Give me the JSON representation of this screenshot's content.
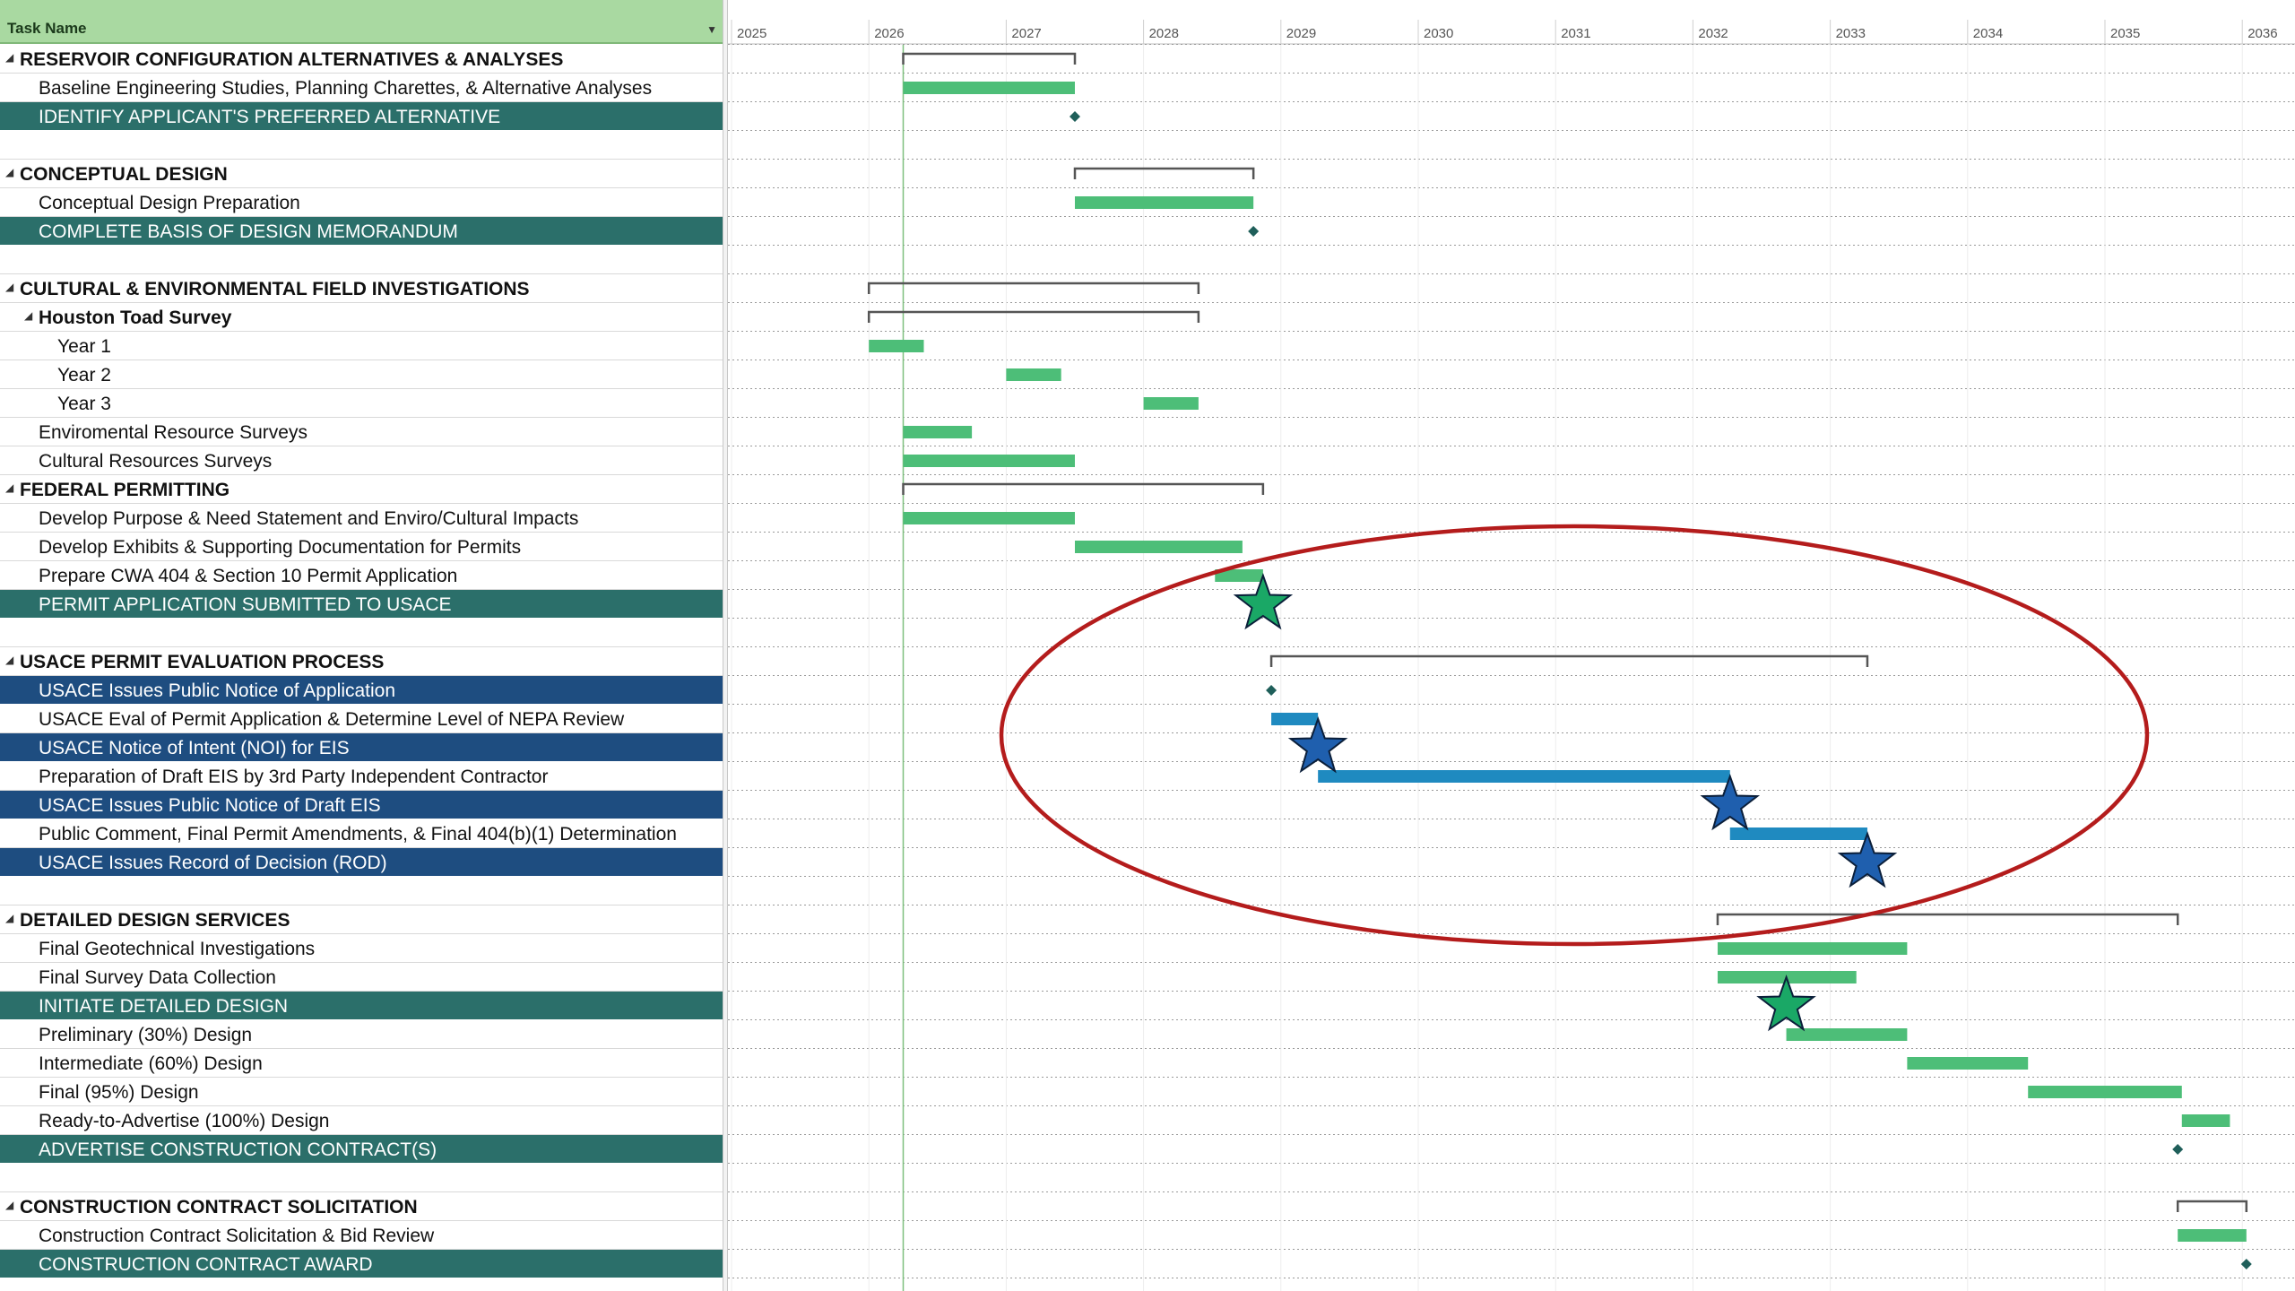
{
  "header": {
    "task_name_label": "Task Name"
  },
  "timescale": {
    "years": [
      "2025",
      "2026",
      "2027",
      "2028",
      "2029",
      "2030",
      "2031",
      "2032",
      "2033",
      "2034",
      "2035",
      "2036"
    ]
  },
  "tasks": [
    {
      "name": "RESERVOIR CONFIGURATION ALTERNATIVES & ANALYSES",
      "kind": "summary",
      "level": 0,
      "start": 2026.25,
      "end": 2027.5
    },
    {
      "name": "Baseline Engineering Studies, Planning Charettes, & Alternative Analyses",
      "kind": "task",
      "level": 1,
      "start": 2026.25,
      "end": 2027.5,
      "color": "green"
    },
    {
      "name": "IDENTIFY APPLICANT'S PREFERRED ALTERNATIVE",
      "kind": "milestone",
      "level": 1,
      "style": "teal",
      "at": 2027.5
    },
    {
      "kind": "blank"
    },
    {
      "name": "CONCEPTUAL DESIGN",
      "kind": "summary",
      "level": 0,
      "start": 2027.5,
      "end": 2028.8
    },
    {
      "name": "Conceptual Design Preparation",
      "kind": "task",
      "level": 1,
      "start": 2027.5,
      "end": 2028.8,
      "color": "green"
    },
    {
      "name": "COMPLETE BASIS OF DESIGN MEMORANDUM",
      "kind": "milestone",
      "level": 1,
      "style": "teal",
      "at": 2028.8
    },
    {
      "kind": "blank"
    },
    {
      "name": "CULTURAL & ENVIRONMENTAL FIELD INVESTIGATIONS",
      "kind": "summary",
      "level": 0,
      "start": 2026.0,
      "end": 2028.4
    },
    {
      "name": "Houston Toad Survey",
      "kind": "summary",
      "level": 1,
      "start": 2026.0,
      "end": 2028.4
    },
    {
      "name": "Year 1",
      "kind": "task",
      "level": 2,
      "start": 2026.0,
      "end": 2026.4,
      "color": "green"
    },
    {
      "name": "Year 2",
      "kind": "task",
      "level": 2,
      "start": 2027.0,
      "end": 2027.4,
      "color": "green"
    },
    {
      "name": "Year 3",
      "kind": "task",
      "level": 2,
      "start": 2028.0,
      "end": 2028.4,
      "color": "green"
    },
    {
      "name": "Enviromental Resource Surveys",
      "kind": "task",
      "level": 1,
      "start": 2026.25,
      "end": 2026.75,
      "color": "green"
    },
    {
      "name": "Cultural Resources Surveys",
      "kind": "task",
      "level": 1,
      "start": 2026.25,
      "end": 2027.5,
      "color": "green"
    },
    {
      "name": "FEDERAL PERMITTING",
      "kind": "summary",
      "level": 0,
      "start": 2026.25,
      "end": 2028.87
    },
    {
      "name": "Develop Purpose & Need Statement and Enviro/Cultural Impacts",
      "kind": "task",
      "level": 1,
      "start": 2026.25,
      "end": 2027.5,
      "color": "green"
    },
    {
      "name": "Develop Exhibits & Supporting Documentation for Permits",
      "kind": "task",
      "level": 1,
      "start": 2027.5,
      "end": 2028.72,
      "color": "green"
    },
    {
      "name": "Prepare CWA 404 & Section 10  Permit Application",
      "kind": "task",
      "level": 1,
      "start": 2028.52,
      "end": 2028.87,
      "color": "green"
    },
    {
      "name": "PERMIT APPLICATION SUBMITTED TO USACE",
      "kind": "milestone",
      "level": 1,
      "style": "teal",
      "at": 2028.87
    },
    {
      "kind": "blank"
    },
    {
      "name": "USACE PERMIT EVALUATION PROCESS",
      "kind": "summary",
      "level": 0,
      "start": 2028.93,
      "end": 2033.27
    },
    {
      "name": "USACE Issues Public Notice of Application",
      "kind": "milestone",
      "level": 1,
      "style": "blue",
      "at": 2028.93
    },
    {
      "name": "USACE Eval of Permit Application & Determine Level of NEPA Review",
      "kind": "task",
      "level": 1,
      "start": 2028.93,
      "end": 2029.27,
      "color": "blue"
    },
    {
      "name": "USACE Notice of Intent (NOI) for EIS",
      "kind": "milestone",
      "level": 1,
      "style": "blue",
      "at": 2029.27
    },
    {
      "name": "Preparation of Draft EIS by 3rd Party Independent Contractor",
      "kind": "task",
      "level": 1,
      "start": 2029.27,
      "end": 2032.27,
      "color": "blue"
    },
    {
      "name": "USACE Issues Public Notice of Draft EIS",
      "kind": "milestone",
      "level": 1,
      "style": "blue",
      "at": 2032.27
    },
    {
      "name": "Public Comment, Final Permit Amendments, & Final 404(b)(1) Determination",
      "kind": "task",
      "level": 1,
      "start": 2032.27,
      "end": 2033.27,
      "color": "blue"
    },
    {
      "name": "USACE Issues Record of Decision (ROD)",
      "kind": "milestone",
      "level": 1,
      "style": "blue",
      "at": 2033.27
    },
    {
      "kind": "blank"
    },
    {
      "name": "DETAILED DESIGN SERVICES",
      "kind": "summary",
      "level": 0,
      "start": 2032.18,
      "end": 2035.53
    },
    {
      "name": "Final Geotechnical Investigations",
      "kind": "task",
      "level": 1,
      "start": 2032.18,
      "end": 2033.56,
      "color": "green"
    },
    {
      "name": "Final Survey Data Collection",
      "kind": "task",
      "level": 1,
      "start": 2032.18,
      "end": 2033.19,
      "color": "green"
    },
    {
      "name": "INITIATE DETAILED DESIGN",
      "kind": "milestone",
      "level": 1,
      "style": "teal",
      "at": 2032.68
    },
    {
      "name": "Preliminary (30%) Design",
      "kind": "task",
      "level": 1,
      "start": 2032.68,
      "end": 2033.56,
      "color": "green"
    },
    {
      "name": "Intermediate (60%) Design",
      "kind": "task",
      "level": 1,
      "start": 2033.56,
      "end": 2034.44,
      "color": "green"
    },
    {
      "name": "Final (95%) Design",
      "kind": "task",
      "level": 1,
      "start": 2034.44,
      "end": 2035.56,
      "color": "green"
    },
    {
      "name": "Ready-to-Advertise (100%) Design",
      "kind": "task",
      "level": 1,
      "start": 2035.56,
      "end": 2035.91,
      "color": "green"
    },
    {
      "name": "ADVERTISE CONSTRUCTION CONTRACT(S)",
      "kind": "milestone",
      "level": 1,
      "style": "teal",
      "at": 2035.53
    },
    {
      "kind": "blank"
    },
    {
      "name": "CONSTRUCTION CONTRACT SOLICITATION",
      "kind": "summary",
      "level": 0,
      "start": 2035.53,
      "end": 2036.03
    },
    {
      "name": "Construction Contract Solicitation & Bid Review",
      "kind": "task",
      "level": 1,
      "start": 2035.53,
      "end": 2036.03,
      "color": "green"
    },
    {
      "name": "CONSTRUCTION CONTRACT AWARD",
      "kind": "milestone",
      "level": 1,
      "style": "teal",
      "at": 2036.03
    }
  ],
  "markers": {
    "status_date": 2026.25,
    "stars": [
      {
        "color": "green",
        "at": 2028.87,
        "row": 19
      },
      {
        "color": "blue",
        "at": 2029.27,
        "row": 24
      },
      {
        "color": "blue",
        "at": 2032.27,
        "row": 26
      },
      {
        "color": "blue",
        "at": 2033.27,
        "row": 28
      },
      {
        "color": "green",
        "at": 2032.68,
        "row": 33
      }
    ],
    "highlight_ellipse": {
      "color": "#b41c1c"
    }
  },
  "colors": {
    "green_bar": "#4dbe78",
    "blue_bar": "#1f8ac0",
    "teal_row": "#2b6f6a",
    "blue_row": "#1e4d80",
    "summary_bracket": "#555555",
    "milestone_diamond": "#1f5f5a",
    "star_green": "#1aa866",
    "star_blue": "#1f5fae",
    "ellipse": "#b41c1c",
    "status_line": "#7fbf7f"
  },
  "chart_data": {
    "type": "gantt",
    "title": "",
    "x_axis": {
      "unit": "year",
      "range": [
        2025,
        2036.4
      ],
      "ticks": [
        "2025",
        "2026",
        "2027",
        "2028",
        "2029",
        "2030",
        "2031",
        "2032",
        "2033",
        "2034",
        "2035",
        "2036"
      ]
    }
  }
}
